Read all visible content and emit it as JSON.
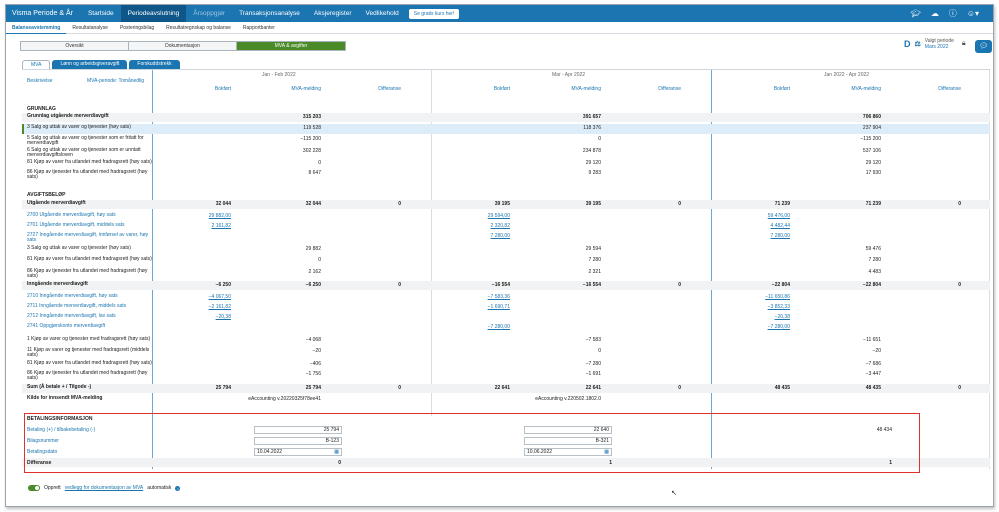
{
  "topnav": {
    "brand": "Visma Periode & År",
    "items": [
      {
        "label": "Startside",
        "state": "normal"
      },
      {
        "label": "Periodeavslutning",
        "state": "active"
      },
      {
        "label": "Årsoppgjør",
        "state": "muted"
      },
      {
        "label": "Transaksjonsanalyse",
        "state": "normal"
      },
      {
        "label": "Aksjeregister",
        "state": "normal"
      },
      {
        "label": "Vedlikehold",
        "state": "normal"
      }
    ],
    "trial_button": "Se gratis kurs her!",
    "icons": [
      "graduation-cap-icon",
      "refresh-cloud-icon",
      "help-icon",
      "user-icon"
    ]
  },
  "subnav": {
    "items": [
      "Balanseavstemming",
      "Resultatanalyse",
      "Posteringsbilag",
      "Resultatregnskap og balanse",
      "Rapportbanter"
    ],
    "active_index": 0
  },
  "segments": {
    "items": [
      "Oversikt",
      "Dokumentasjon",
      "MVA & avgifter"
    ],
    "active_index": 2
  },
  "period": {
    "label": "Valgt periode",
    "value": "Mars 2022"
  },
  "tabs": {
    "items": [
      "MVA",
      "Lønn og arbeidsgiveravgift",
      "Forskuddstrekk"
    ],
    "active_index": 0
  },
  "table": {
    "desc_header": "Beskrivelse",
    "mva_period_header": "MVA-periode: Tomånedlig",
    "period_headers": [
      "Jan - Feb 2022",
      "Mar - Apr 2022",
      "Jan 2022 - Apr 2022"
    ],
    "col_headers": [
      "Bokført",
      "MVA-melding",
      "Differanse"
    ],
    "sections": {
      "grunnlag": "GRUNNLAG",
      "avgift": "AVGIFTSBELØP",
      "betaling": "BETALINGSINFORMASJON"
    },
    "rows": {
      "grunnlag_total": {
        "label": "Grunnlag utgående merverdiavgift",
        "values": [
          "",
          "315 203",
          "",
          "",
          "391 657",
          "",
          "",
          "706 860",
          ""
        ]
      },
      "r3": {
        "label": "3 Salg og uttak av varer og tjenester (høy sats)",
        "values": [
          "",
          "119 528",
          "",
          "",
          "118 376",
          "",
          "",
          "237 904",
          ""
        ]
      },
      "r5": {
        "label": "5 Salg og uttak av varer og tjenester som er fritatt for merverdiavgift",
        "values": [
          "",
          "−115 200",
          "",
          "",
          "0",
          "",
          "",
          "−115 200",
          ""
        ]
      },
      "r6": {
        "label": "6 Salg og uttak av varer og tjenester som er unntatt merverdiavgiftsloven",
        "values": [
          "",
          "302 228",
          "",
          "",
          "234 878",
          "",
          "",
          "537 106",
          ""
        ]
      },
      "r81": {
        "label": "81 Kjøp av varer fra utlandet med fradragsrett (høy sats)",
        "values": [
          "",
          "0",
          "",
          "",
          "29 120",
          "",
          "",
          "29 120",
          ""
        ]
      },
      "r86": {
        "label": "86 Kjøp av tjenester fra utlandet med fradragsrett (høy sats)",
        "values": [
          "",
          "8 647",
          "",
          "",
          "9 283",
          "",
          "",
          "17 930",
          ""
        ]
      },
      "utg_total": {
        "label": "Utgående merverdiavgift",
        "values": [
          "32 044",
          "32 044",
          "0",
          "39 195",
          "39 195",
          "0",
          "71 239",
          "71 239",
          "0"
        ]
      },
      "a2700": {
        "label": "2700 Utgående merverdiavgift, høy sats",
        "values": [
          "29 882,00",
          "",
          "",
          "29 594,00",
          "",
          "",
          "59 476,00",
          "",
          ""
        ]
      },
      "a2701": {
        "label": "2701 Utgående merverdiavgift, middels sats",
        "values": [
          "2 161,82",
          "",
          "",
          "2 320,82",
          "",
          "",
          "4 482,44",
          "",
          ""
        ]
      },
      "a2727": {
        "label": "2727 Inngående merverdiavgift, innførsel av varer, høy sats",
        "values": [
          "",
          "",
          "",
          "7 280,00",
          "",
          "",
          "7 280,00",
          "",
          ""
        ]
      },
      "u3": {
        "label": "3 Salg og uttak av varer og tjenester (høy sats)",
        "values": [
          "",
          "29 882",
          "",
          "",
          "29 594",
          "",
          "",
          "59 476",
          ""
        ]
      },
      "u81": {
        "label": "81 Kjøp av varer fra utlandet med fradragsrett (høy sats)",
        "values": [
          "",
          "0",
          "",
          "",
          "7 280",
          "",
          "",
          "7 280",
          ""
        ]
      },
      "u86": {
        "label": "86 Kjøp av tjenester fra utlandet med fradragsrett (høy sats)",
        "values": [
          "",
          "2 162",
          "",
          "",
          "2 321",
          "",
          "",
          "4 483",
          ""
        ]
      },
      "inn_total": {
        "label": "Inngående merverdiavgift",
        "values": [
          "−6 250",
          "−6 250",
          "0",
          "−16 554",
          "−16 554",
          "0",
          "−22 804",
          "−22 804",
          "0"
        ]
      },
      "a2710": {
        "label": "2710 Inngående merverdiavgift, høy sats",
        "values": [
          "−4 067,50",
          "",
          "",
          "−7 583,36",
          "",
          "",
          "−11 650,86",
          "",
          ""
        ]
      },
      "a2711": {
        "label": "2711 Inngående merverdiavgift, middels sats",
        "values": [
          "−2 161,82",
          "",
          "",
          "−1 690,71",
          "",
          "",
          "−3 852,33",
          "",
          ""
        ]
      },
      "a2712": {
        "label": "2712 Inngående merverdiavgift, lav sats",
        "values": [
          "−20,38",
          "",
          "",
          "",
          "",
          "",
          "−20,38",
          "",
          ""
        ]
      },
      "a2741": {
        "label": "2741 Oppgjørskonto merverdiavgift",
        "values": [
          "",
          "",
          "",
          "−7 280,00",
          "",
          "",
          "−7 280,00",
          "",
          ""
        ]
      },
      "i1": {
        "label": "1 Kjøp av varer og tjenester med fradragsrett (høy sats)",
        "values": [
          "",
          "−4 068",
          "",
          "",
          "−7 583",
          "",
          "",
          "−11 651",
          ""
        ]
      },
      "i11": {
        "label": "11 Kjøp av varer og tjenester med fradragsrett (middels sats)",
        "values": [
          "",
          "−20",
          "",
          "",
          "0",
          "",
          "",
          "−20",
          ""
        ]
      },
      "i81": {
        "label": "81 Kjøp av varer fra utlandet med fradragsrett (høy sats)",
        "values": [
          "",
          "−406",
          "",
          "",
          "−7 280",
          "",
          "",
          "−7 686",
          ""
        ]
      },
      "i86": {
        "label": "86 Kjøp av tjenester fra utlandet med fradragsrett (høy sats)",
        "values": [
          "",
          "−1 756",
          "",
          "",
          "−1 691",
          "",
          "",
          "−3 447",
          ""
        ]
      },
      "sum": {
        "label": "Sum (Å betale + / Tilgode -)",
        "values": [
          "25 794",
          "25 794",
          "0",
          "22 641",
          "22 641",
          "0",
          "48 435",
          "48 435",
          "0"
        ]
      },
      "kilde": {
        "label": "Kilde for innsendt MVA-melding",
        "values": [
          "",
          "eAccounting v.20220325f78ee41",
          "",
          "",
          "eAccounting v.220502.1802.0",
          "",
          "",
          "",
          ""
        ]
      }
    },
    "payment": {
      "betaling_label": "Betaling (+) / tilbakebetaling (-)",
      "bilag_label": "Bilagsnummer",
      "dato_label": "Betalingsdato",
      "diff_label": "Differanse",
      "p1": {
        "betaling": "25 794",
        "bilag": "B-123",
        "dato": "10.04.2022",
        "diff": "0"
      },
      "p2": {
        "betaling": "22 640",
        "bilag": "B-321",
        "dato": "10.06.2022",
        "diff": "1"
      },
      "total": {
        "betaling": "48 434",
        "diff": "1"
      }
    }
  },
  "footer": {
    "prefix": "Opprett",
    "link": "vedlegg for dokumentasjon av MVA",
    "suffix": "automatisk"
  }
}
